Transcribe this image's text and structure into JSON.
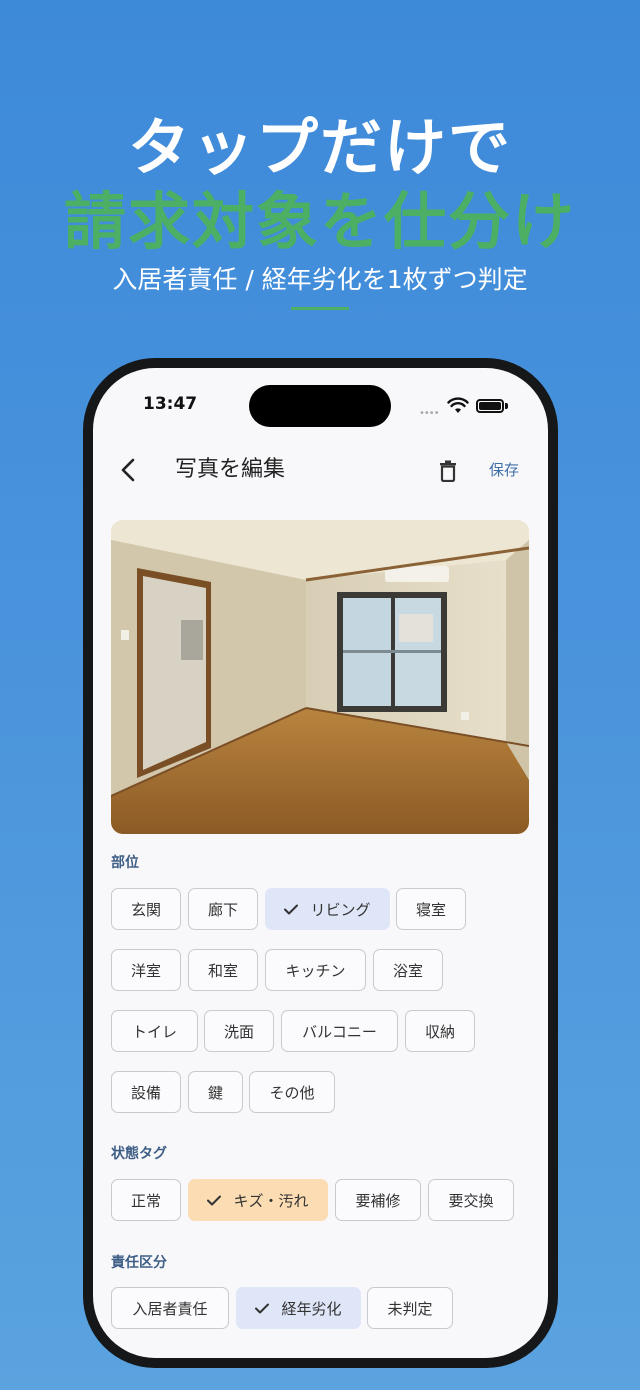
{
  "hero": {
    "title_line1": "タップだけで",
    "title_line2": "請求対象を仕分け",
    "subtitle": "入居者責任 / 経年劣化を1枚ずつ判定"
  },
  "status_bar": {
    "time": "13:47",
    "signal_dots": "••••"
  },
  "navbar": {
    "title": "写真を編集",
    "save_label": "保存"
  },
  "location": {
    "label": "部位",
    "chips": [
      {
        "label": "玄関",
        "selected": false
      },
      {
        "label": "廊下",
        "selected": false
      },
      {
        "label": "リビング",
        "selected": true
      },
      {
        "label": "寝室",
        "selected": false
      },
      {
        "label": "洋室",
        "selected": false
      },
      {
        "label": "和室",
        "selected": false
      },
      {
        "label": "キッチン",
        "selected": false
      },
      {
        "label": "浴室",
        "selected": false
      },
      {
        "label": "トイレ",
        "selected": false
      },
      {
        "label": "洗面",
        "selected": false
      },
      {
        "label": "バルコニー",
        "selected": false
      },
      {
        "label": "収納",
        "selected": false
      },
      {
        "label": "設備",
        "selected": false
      },
      {
        "label": "鍵",
        "selected": false
      },
      {
        "label": "その他",
        "selected": false
      }
    ]
  },
  "condition": {
    "label": "状態タグ",
    "chips": [
      {
        "label": "正常",
        "selected": false
      },
      {
        "label": "キズ・汚れ",
        "selected": true
      },
      {
        "label": "要補修",
        "selected": false
      },
      {
        "label": "要交換",
        "selected": false
      }
    ]
  },
  "responsibility": {
    "label": "責任区分",
    "chips": [
      {
        "label": "入居者責任",
        "selected": false
      },
      {
        "label": "経年劣化",
        "selected": true
      },
      {
        "label": "未判定",
        "selected": false
      }
    ]
  },
  "colors": {
    "background": "#4a93dc",
    "accent_green": "#4caf63",
    "selected_blue": "#dfe6f7",
    "selected_orange": "#fbdcb3",
    "link_blue": "#3f6fa8"
  }
}
